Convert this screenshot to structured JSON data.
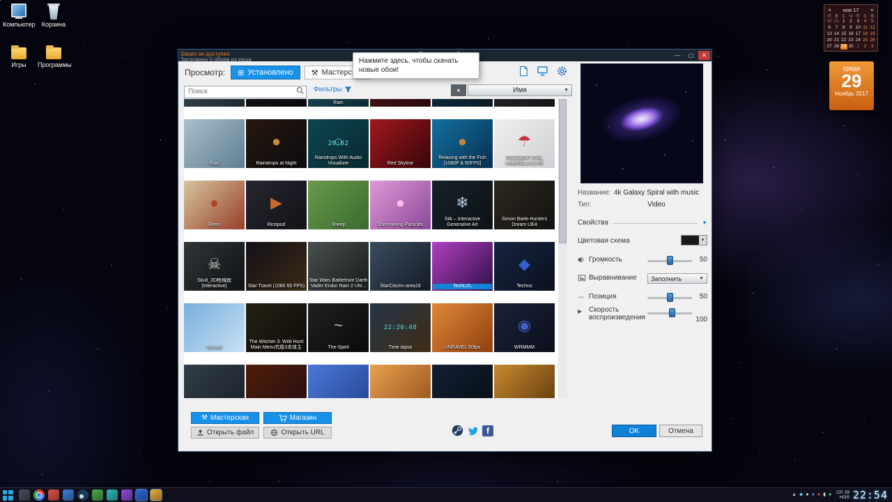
{
  "desktop": {
    "icons": [
      {
        "id": "computer",
        "label": "Компьютер",
        "type": "computer"
      },
      {
        "id": "recycle-bin",
        "label": "Корзина",
        "type": "recycle"
      },
      {
        "id": "games",
        "label": "Игры",
        "type": "folder"
      },
      {
        "id": "programs",
        "label": "Программы",
        "type": "folder"
      }
    ],
    "calendar": {
      "header": "ноя 17",
      "weekdays": [
        "П",
        "В",
        "С",
        "Ч",
        "П",
        "С",
        "В"
      ],
      "weeks": [
        [
          "30",
          "31",
          "1",
          "2",
          "3",
          "4",
          "5"
        ],
        [
          "6",
          "7",
          "8",
          "9",
          "10",
          "11",
          "12"
        ],
        [
          "13",
          "14",
          "15",
          "16",
          "17",
          "18",
          "19"
        ],
        [
          "20",
          "21",
          "22",
          "23",
          "24",
          "25",
          "26"
        ],
        [
          "27",
          "28",
          "29",
          "30",
          "1",
          "2",
          "3"
        ]
      ],
      "selected_day": "29",
      "selected_week": 4
    },
    "date_card": {
      "weekday": "среда",
      "day": "29",
      "month_year": "Ноябрь 2017",
      "accent": "#e8821a"
    }
  },
  "window": {
    "title": "Просмотр обоев",
    "status_line1": "Steam не доступен",
    "status_line2": "Загружено 0 обоев из кеша",
    "view_label": "Просмотр:",
    "tabs": [
      {
        "label": "Установлено"
      },
      {
        "label": "Мастерская"
      }
    ],
    "tooltip": "Нажмите здесь, чтобы скачать новые обои!",
    "search_placeholder": "Поиск",
    "filters_label": "Фильтры",
    "sort_value": "Имя",
    "buttons": {
      "workshop": "Мастерская",
      "store": "Магазин",
      "open_file": "Открыть файл",
      "open_url": "Открыть URL"
    },
    "accent": "#1690e8"
  },
  "grid": {
    "top_partial": [
      {
        "c1": "#2e3e48",
        "c2": "#1e2a32"
      },
      {
        "c1": "#101014",
        "c2": "#0a0a0e"
      },
      {
        "t": "Rain",
        "c1": "#18424e",
        "c2": "#0d2a33"
      },
      {
        "c1": "#401014",
        "c2": "#280a0c"
      },
      {
        "c1": "#0e2838",
        "c2": "#081a26"
      },
      {
        "c1": "#202028",
        "c2": "#141418"
      }
    ],
    "items": [
      {
        "t": "Rain",
        "c1": "#a8c0ce",
        "c2": "#5e7e90"
      },
      {
        "t": "Raindrops at Night",
        "c1": "#26180e",
        "c2": "#0c0a10",
        "g": "●",
        "gc": "#e8a040"
      },
      {
        "t": "Raindrops With Audio Visualizer",
        "c1": "#0e4652",
        "c2": "#082830",
        "g": "○",
        "gc": "#3ad8d8",
        "ov": "20:02",
        "ovc": "#7ae8e8"
      },
      {
        "t": "Red Skyline",
        "c1": "#a01820",
        "c2": "#380608"
      },
      {
        "t": "Relaxing with the Fish [1080P & 60FPS]",
        "c1": "#1270a0",
        "c2": "#083050",
        "g": "●",
        "gc": "#e88a30"
      },
      {
        "t": "RESIDENT EVIL UMBRELLA LIVE",
        "c1": "#f0f0f0",
        "c2": "#d0d0d4",
        "g": "☂",
        "gc": "#c01820"
      },
      {
        "t": "Retro",
        "c1": "#d8c4a0",
        "c2": "#98402a",
        "g": "●",
        "gc": "#a8401f"
      },
      {
        "t": "Ricepod",
        "c1": "#262630",
        "c2": "#121218",
        "g": "▶",
        "gc": "#e87830"
      },
      {
        "t": "Sheep",
        "c1": "#6a9a4a",
        "c2": "#3a6a30"
      },
      {
        "t": "Shimmering Particles",
        "c1": "#e098d8",
        "c2": "#8a4898",
        "g": "●",
        "gc": "#ffd0f0"
      },
      {
        "t": "Silk – Interactive Generative Art",
        "c1": "#182028",
        "c2": "#0c1218",
        "g": "❄",
        "gc": "#cfe4ff"
      },
      {
        "t": "Simon Barle-Hunters Dream UE4",
        "c1": "#2c2820",
        "c2": "#141210"
      },
      {
        "t": "Skull_3D枪械模 [Interactive]",
        "c1": "#303438",
        "c2": "#101214",
        "g": "☠",
        "gc": "#e8e8e0"
      },
      {
        "t": "Star Travel (1080 60 FPS)",
        "c1": "#141018",
        "c2": "#3a2a14"
      },
      {
        "t": "Star Wars Battlefront Darth Vader Endor Rain 2 Ultr...",
        "c1": "#48504e",
        "c2": "#181c1e"
      },
      {
        "t": "StarCitizen-area18",
        "c1": "#3a4c5e",
        "c2": "#141c26"
      },
      {
        "t": "TechLVL",
        "c1": "#b040c0",
        "c2": "#301048",
        "sel": true
      },
      {
        "t": "Techno",
        "c1": "#16243e",
        "c2": "#0a1020",
        "g": "◆",
        "gc": "#3a6ae8"
      },
      {
        "t": "Terrace",
        "c1": "#78aede",
        "c2": "#c8e0f2"
      },
      {
        "t": "The Witcher 3: Wild Hunt Main Menu究极3本体主",
        "c1": "#242014",
        "c2": "#0f0d08"
      },
      {
        "t": "The-Spirit",
        "c1": "#202020",
        "c2": "#0a0a0a",
        "g": "~",
        "gc": "#d8d8d8"
      },
      {
        "t": "Time lapse",
        "c1": "#243648",
        "c2": "#402c14",
        "ov": "22:20:48",
        "ovc": "#50e0e8"
      },
      {
        "t": "UNRAVEL 60fps",
        "c1": "#e08838",
        "c2": "#90400e"
      },
      {
        "t": "WRMMM",
        "c1": "#1a2238",
        "c2": "#0c0e1c",
        "g": "◉",
        "gc": "#4a6ae8"
      }
    ],
    "bottom_partial": [
      {
        "c1": "#323e4a",
        "c2": "#1c242e"
      },
      {
        "c1": "#501c0a",
        "c2": "#2a1210"
      },
      {
        "c1": "#4a7ad8",
        "c2": "#2a4a9a"
      },
      {
        "c1": "#e8a050",
        "c2": "#a05a20"
      },
      {
        "c1": "#122034",
        "c2": "#081018"
      },
      {
        "c1": "#c88a30",
        "c2": "#6a4210"
      }
    ]
  },
  "sidebar": {
    "name_label": "Название:",
    "name_value": "4k Galaxy Spiral with music",
    "type_label": "Тип:",
    "type_value": "Video",
    "properties_label": "Свойства",
    "color_scheme_label": "Цветовая схема",
    "volume_label": "Громкость",
    "volume_value": "50",
    "volume_percent": 50,
    "alignment_label": "Выравнивание",
    "alignment_value": "Заполнить",
    "position_label": "Позиция",
    "position_value": "50",
    "position_percent": 50,
    "speed_label": "Скорость воспроизведения",
    "speed_value": "100",
    "speed_percent": 55,
    "ok_label": "OK",
    "cancel_label": "Отмена"
  },
  "taskbar": {
    "icons": [
      {
        "name": "system-monitor-icon",
        "c": "#464c58"
      },
      {
        "name": "chrome-icon",
        "c": "#e8c03a",
        "special": "chrome"
      },
      {
        "name": "media-player-icon",
        "c": "#d8504a"
      },
      {
        "name": "browser-icon",
        "c": "#3a7ad8"
      },
      {
        "name": "steam-icon",
        "c": "#1e3a5a",
        "special": "steam"
      },
      {
        "name": "app-green-icon",
        "c": "#4aa84a"
      },
      {
        "name": "app-teal-icon",
        "c": "#2ab8b8"
      },
      {
        "name": "app-purple-icon",
        "c": "#8a4ad8"
      },
      {
        "name": "wallpaper-engine-icon",
        "c": "#2a6ad8",
        "active": true
      },
      {
        "name": "explorer-icon",
        "c": "#e8a83a",
        "active": true
      }
    ],
    "tray": [
      {
        "g": "▲",
        "c": "#b8c0c8"
      },
      {
        "g": "◆",
        "c": "#4ac8e8"
      },
      {
        "g": "●",
        "c": "#e8e8e8"
      },
      {
        "g": "●",
        "c": "#4a9ae8"
      },
      {
        "g": "●",
        "c": "#e85a4a"
      },
      {
        "g": "▮",
        "c": "#c8d0d8"
      },
      {
        "g": "●",
        "c": "#4ae87a"
      }
    ],
    "clock_date": "СР. 29",
    "clock_month": "НОЯ",
    "clock_time": "22:54"
  }
}
